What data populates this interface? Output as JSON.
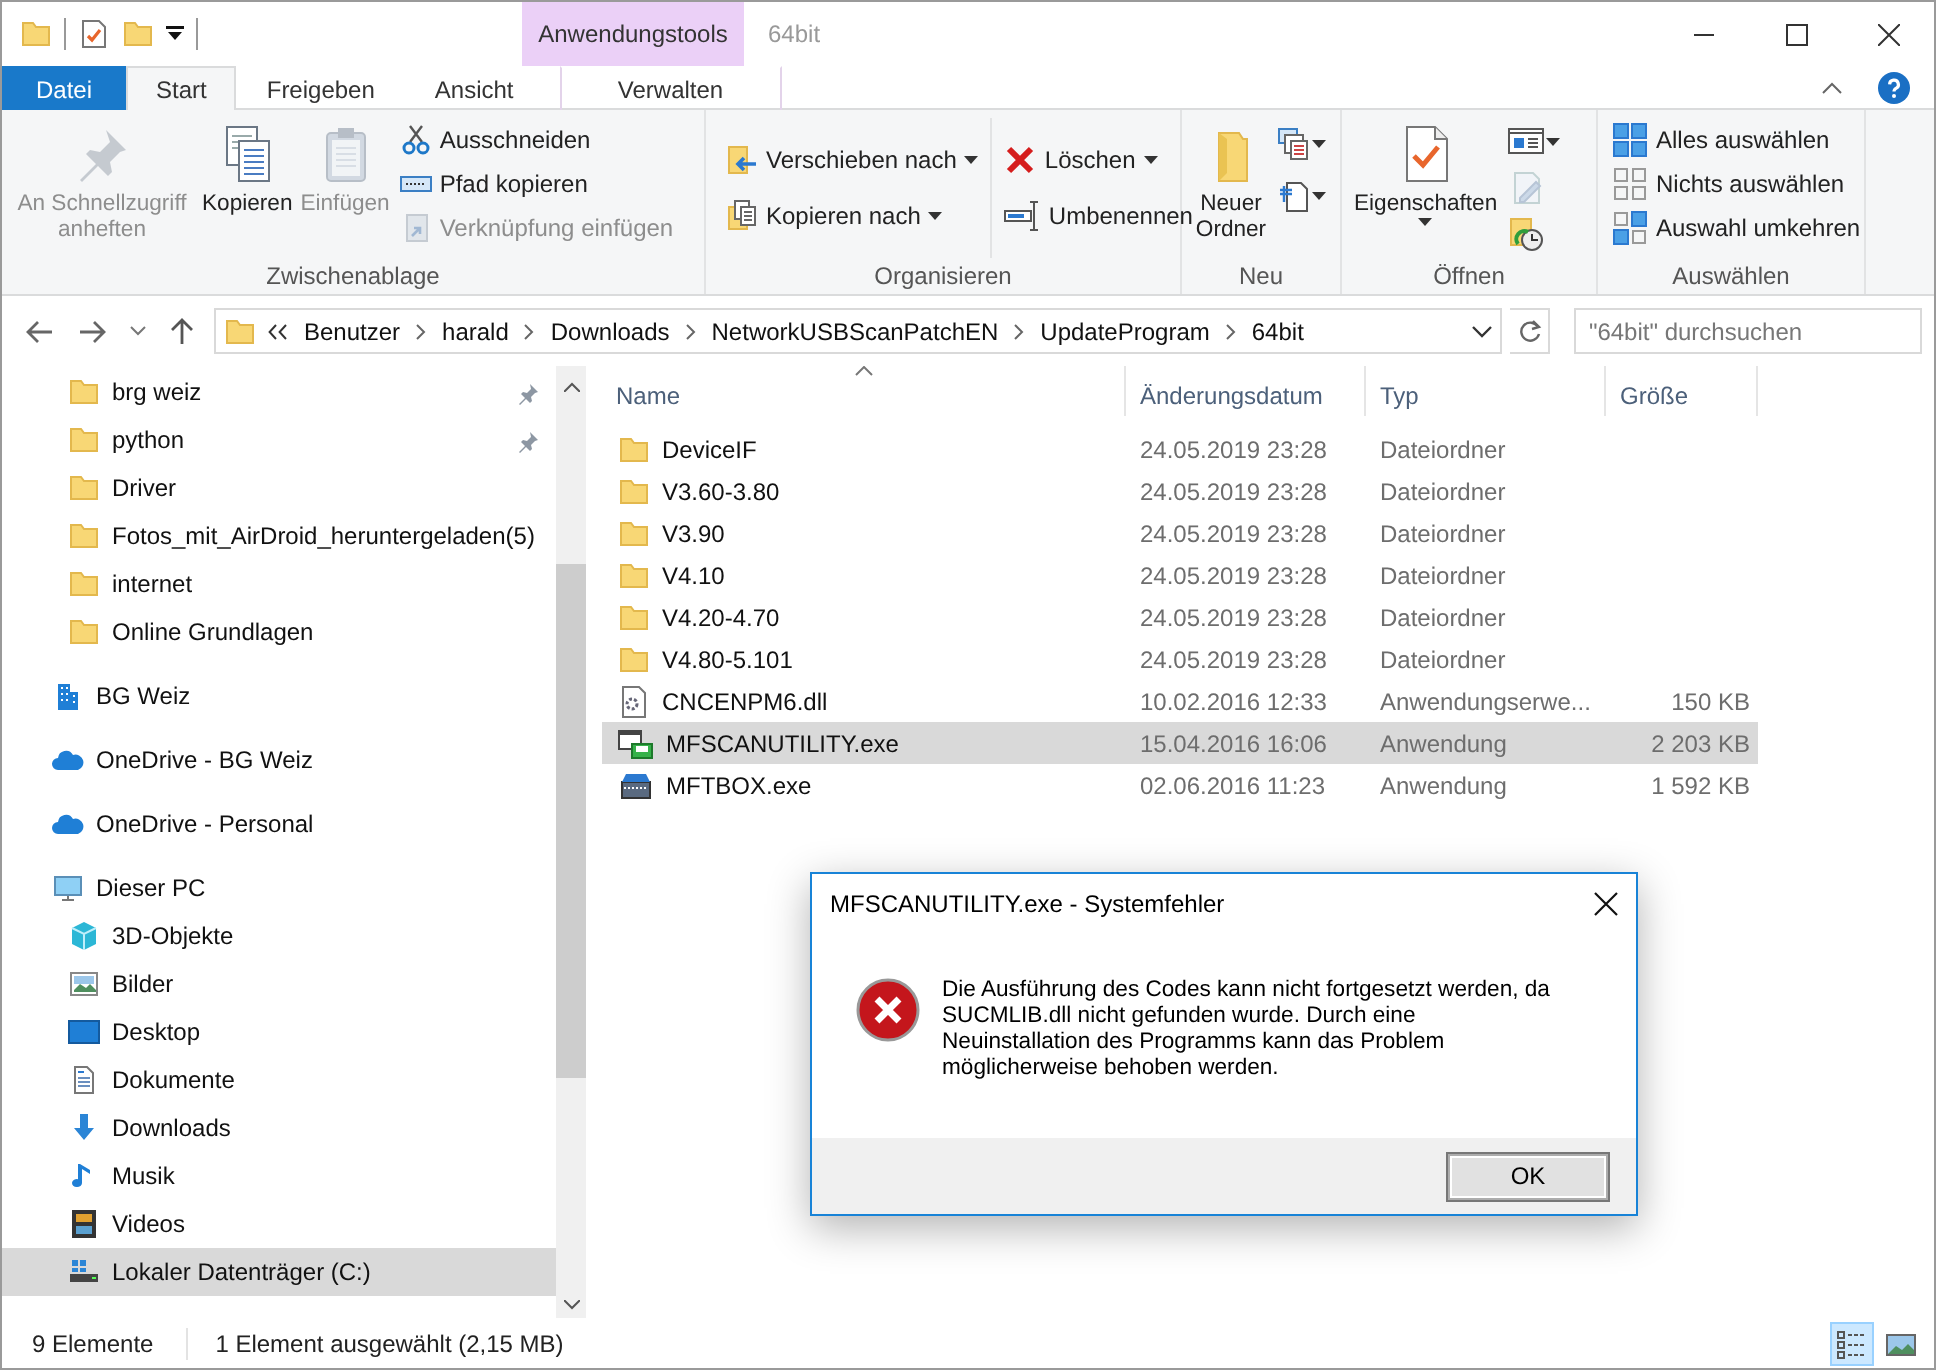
{
  "title_bar": {
    "context_group": "Anwendungstools",
    "title": "64bit"
  },
  "ribbon_tabs": [
    {
      "label": "Datei",
      "kind": "file",
      "selected": false
    },
    {
      "label": "Start",
      "kind": "plain",
      "selected": true
    },
    {
      "label": "Freigeben",
      "kind": "plain",
      "selected": false
    },
    {
      "label": "Ansicht",
      "kind": "plain",
      "selected": false
    },
    {
      "label": "Verwalten",
      "kind": "context",
      "selected": false
    }
  ],
  "ribbon_groups": [
    {
      "label": "Zwischenablage",
      "columns": [
        [
          {
            "kind": "large",
            "label": "An Schnellzugriff anheften",
            "disabled": true,
            "dropdown": false
          }
        ],
        [
          {
            "kind": "large",
            "label": "Kopieren",
            "disabled": false,
            "dropdown": false
          }
        ],
        [
          {
            "kind": "large",
            "label": "Einfügen",
            "disabled": true,
            "dropdown": false
          }
        ],
        [
          {
            "kind": "small",
            "label": "Ausschneiden",
            "disabled": false,
            "dropdown": false
          },
          {
            "kind": "small",
            "label": "Pfad kopieren",
            "disabled": false,
            "dropdown": false
          },
          {
            "kind": "small",
            "label": "Verknüpfung einfügen",
            "disabled": true,
            "dropdown": false
          }
        ]
      ]
    },
    {
      "label": "Organisieren",
      "columns": [
        [
          {
            "kind": "small",
            "label": "Verschieben nach",
            "disabled": false,
            "dropdown": true
          },
          {
            "kind": "small",
            "label": "Kopieren nach",
            "disabled": false,
            "dropdown": true
          }
        ],
        [
          {
            "kind": "small",
            "label": "Löschen",
            "disabled": false,
            "dropdown": true
          },
          {
            "kind": "small",
            "label": "Umbenennen",
            "disabled": false,
            "dropdown": false
          }
        ]
      ]
    },
    {
      "label": "Neu",
      "columns": [
        [
          {
            "kind": "large",
            "label": "Neuer Ordner",
            "disabled": false,
            "dropdown": false
          }
        ],
        [
          {
            "kind": "icon",
            "disabled": false,
            "dropdown": true
          },
          {
            "kind": "icon",
            "disabled": false,
            "dropdown": true
          }
        ]
      ]
    },
    {
      "label": "Öffnen",
      "columns": [
        [
          {
            "kind": "large",
            "label": "Eigenschaften",
            "disabled": false,
            "dropdown": true
          }
        ],
        [
          {
            "kind": "icon",
            "disabled": false,
            "dropdown": true
          },
          {
            "kind": "icon",
            "disabled": true,
            "dropdown": false
          },
          {
            "kind": "icon",
            "disabled": false,
            "dropdown": false
          }
        ]
      ]
    },
    {
      "label": "Auswählen",
      "columns": [
        [
          {
            "kind": "small",
            "label": "Alles auswählen",
            "disabled": false,
            "dropdown": false
          },
          {
            "kind": "small",
            "label": "Nichts auswählen",
            "disabled": false,
            "dropdown": false
          },
          {
            "kind": "small",
            "label": "Auswahl umkehren",
            "disabled": false,
            "dropdown": false
          }
        ]
      ]
    }
  ],
  "address": {
    "breadcrumbs": [
      "Benutzer",
      "harald",
      "Downloads",
      "NetworkUSBScanPatchEN",
      "UpdateProgram",
      "64bit"
    ]
  },
  "search": {
    "placeholder": "\"64bit\" durchsuchen"
  },
  "quick_access": [
    {
      "label": "brg weiz",
      "pinned": true,
      "selected": false
    },
    {
      "label": "python",
      "pinned": true,
      "selected": false
    },
    {
      "label": "Driver",
      "pinned": false,
      "selected": false
    },
    {
      "label": "Fotos_mit_AirDroid_heruntergeladen(5)",
      "pinned": false,
      "selected": false
    },
    {
      "label": "internet",
      "pinned": false,
      "selected": false
    },
    {
      "label": "Online Grundlagen",
      "pinned": false,
      "selected": false
    }
  ],
  "nav_tree": [
    {
      "label": "BG Weiz",
      "selected": false
    },
    {
      "label": "OneDrive - BG Weiz",
      "selected": false
    },
    {
      "label": "OneDrive - Personal",
      "selected": false
    },
    {
      "label": "Dieser PC",
      "selected": false,
      "children": [
        {
          "label": "3D-Objekte",
          "selected": false
        },
        {
          "label": "Bilder",
          "selected": false
        },
        {
          "label": "Desktop",
          "selected": false
        },
        {
          "label": "Dokumente",
          "selected": false
        },
        {
          "label": "Downloads",
          "selected": false
        },
        {
          "label": "Musik",
          "selected": false
        },
        {
          "label": "Videos",
          "selected": false
        },
        {
          "label": "Lokaler Datenträger (C:)",
          "selected": true
        }
      ]
    }
  ],
  "file_list": {
    "columns": [
      {
        "label": "Name",
        "sorted": true
      },
      {
        "label": "Änderungsdatum",
        "sorted": false
      },
      {
        "label": "Typ",
        "sorted": false
      },
      {
        "label": "Größe",
        "sorted": false
      }
    ],
    "rows": [
      {
        "kind": "folder",
        "name": "DeviceIF",
        "date": "24.05.2019 23:28",
        "type": "Dateiordner",
        "selected": false
      },
      {
        "kind": "folder",
        "name": "V3.60-3.80",
        "date": "24.05.2019 23:28",
        "type": "Dateiordner",
        "selected": false
      },
      {
        "kind": "folder",
        "name": "V3.90",
        "date": "24.05.2019 23:28",
        "type": "Dateiordner",
        "selected": false
      },
      {
        "kind": "folder",
        "name": "V4.10",
        "date": "24.05.2019 23:28",
        "type": "Dateiordner",
        "selected": false
      },
      {
        "kind": "folder",
        "name": "V4.20-4.70",
        "date": "24.05.2019 23:28",
        "type": "Dateiordner",
        "selected": false
      },
      {
        "kind": "folder",
        "name": "V4.80-5.101",
        "date": "24.05.2019 23:28",
        "type": "Dateiordner",
        "selected": false
      },
      {
        "kind": "library",
        "name": "CNCENPM6.dll",
        "date": "10.02.2016 12:33",
        "type": "Anwendungserwe...",
        "size": "150 KB",
        "selected": false
      },
      {
        "kind": "scanner_app",
        "name": "MFSCANUTILITY.exe",
        "date": "15.04.2016 16:06",
        "type": "Anwendung",
        "size": "2 203 KB",
        "selected": true
      },
      {
        "kind": "toolbox_app",
        "name": "MFTBOX.exe",
        "date": "02.06.2016 11:23",
        "type": "Anwendung",
        "size": "1 592 KB",
        "selected": false
      }
    ]
  },
  "status_bar": {
    "item_count": "9 Elemente",
    "selection": "1 Element ausgewählt (2,15 MB)",
    "views": [
      {
        "kind": "details",
        "selected": true
      },
      {
        "kind": "large_icons",
        "selected": false
      }
    ]
  },
  "dialog": {
    "title": "MFSCANUTILITY.exe - Systemfehler",
    "message": "Die Ausführung des Codes kann nicht fortgesetzt werden, da SUCMLIB.dll nicht gefunden wurde. Durch eine Neuinstallation des Programms kann das Problem möglicherweise behoben werden.",
    "button": "OK"
  }
}
